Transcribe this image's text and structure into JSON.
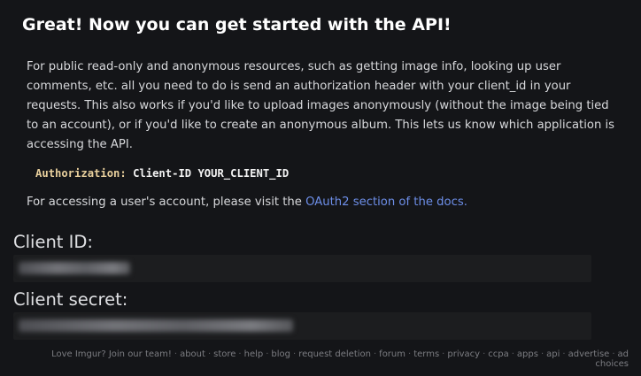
{
  "header": {
    "title": "Great! Now you can get started with the API!"
  },
  "intro": {
    "text": "For public read-only and anonymous resources, such as getting image info, looking up user comments, etc. all you need to do is send an authorization header with your client_id in your requests. This also works if you'd like to upload images anonymously (without the image being tied to an account), or if you'd like to create an anonymous album. This lets us know which application is accessing the API."
  },
  "auth_example": {
    "key": "Authorization:",
    "value": "Client-ID YOUR_CLIENT_ID"
  },
  "oauth": {
    "prefix": "For accessing a user's account, please visit the ",
    "link_text": "OAuth2 section of the docs."
  },
  "fields": {
    "client_id_label": "Client ID:",
    "client_secret_label": "Client secret:"
  },
  "footer": {
    "links": [
      "Love Imgur? Join our team!",
      "about",
      "store",
      "help",
      "blog",
      "request deletion",
      "forum",
      "terms",
      "privacy",
      "ccpa",
      "apps",
      "api",
      "advertise",
      "ad choices"
    ]
  },
  "colors": {
    "background": "#141518",
    "link": "#6d8ee8",
    "code_key": "#e8cf9c"
  }
}
